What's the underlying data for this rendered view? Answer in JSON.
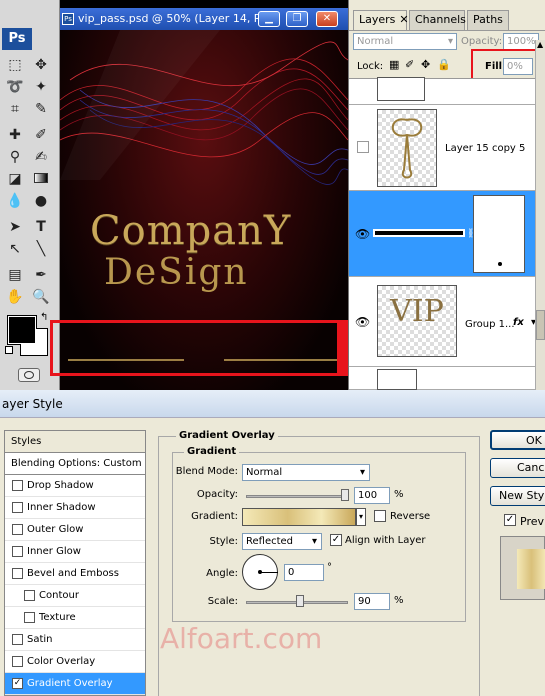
{
  "app": {
    "logo": "Ps"
  },
  "document": {
    "title": "vip_pass.psd @ 50% (Layer 14, R...",
    "brand_line1": "CompanY",
    "brand_line2": "DeSign"
  },
  "layers_panel": {
    "tabs": [
      {
        "label": "Layers"
      },
      {
        "label": "Channels"
      },
      {
        "label": "Paths"
      }
    ],
    "blend_mode": "Normal",
    "opacity_label": "Opacity:",
    "opacity_value": "100%",
    "lock_label": "Lock:",
    "fill_label": "Fill:",
    "fill_value": "0%",
    "layers": [
      {
        "name": ""
      },
      {
        "name": "Layer 15 copy 5"
      },
      {
        "name": ""
      },
      {
        "name": "Group 1...",
        "fx": "fx",
        "thumb_text": "VIP"
      }
    ]
  },
  "dialog": {
    "title": "ayer Style",
    "styles_header": "Styles",
    "blending_options": "Blending Options: Custom",
    "style_items": [
      {
        "label": "Drop Shadow",
        "checked": false
      },
      {
        "label": "Inner Shadow",
        "checked": false
      },
      {
        "label": "Outer Glow",
        "checked": false
      },
      {
        "label": "Inner Glow",
        "checked": false
      },
      {
        "label": "Bevel and Emboss",
        "checked": false
      },
      {
        "label": "Contour",
        "checked": false
      },
      {
        "label": "Texture",
        "checked": false
      },
      {
        "label": "Satin",
        "checked": false
      },
      {
        "label": "Color Overlay",
        "checked": false
      },
      {
        "label": "Gradient Overlay",
        "checked": true
      }
    ],
    "section_title": "Gradient Overlay",
    "group_title": "Gradient",
    "blend_mode_label": "Blend Mode:",
    "blend_mode_value": "Normal",
    "opacity_label": "Opacity:",
    "opacity_value": "100",
    "opacity_unit": "%",
    "opacity_level": 100,
    "gradient_label": "Gradient:",
    "reverse_label": "Reverse",
    "style_label": "Style:",
    "style_value": "Reflected",
    "align_label": "Align with Layer",
    "angle_label": "Angle:",
    "angle_value": "0",
    "angle_unit": "°",
    "scale_label": "Scale:",
    "scale_value": "90",
    "scale_unit": "%",
    "scale_level": 90,
    "ok_label": "OK",
    "cancel_label": "Cance",
    "new_style_label": "New Sty",
    "preview_label": "Prev"
  },
  "watermark": "Alfoart.com",
  "colors": {
    "accent": "#3399ff",
    "highlight_box": "#e8141c",
    "gold": "#c9a85a"
  }
}
